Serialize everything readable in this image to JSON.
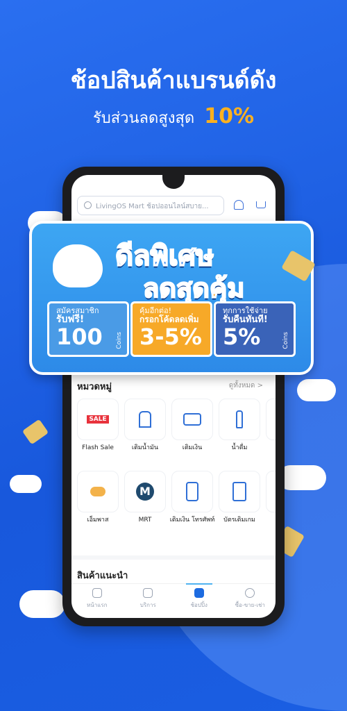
{
  "promo": {
    "headline": "ช้อปสินค้าแบรนด์ดัง",
    "subline": "รับส่วนลดสูงสุด",
    "subline_value": "10%",
    "accent": "#ffb11f"
  },
  "app": {
    "search_placeholder": "LivingOS Mart ช้อปออนไลน์สบาย...",
    "categories_title": "หมวดหมู่",
    "see_all": "ดูทั้งหมด >",
    "categories": [
      {
        "label": "Flash Sale",
        "icon": "flash-sale-icon"
      },
      {
        "label": "เติมน้ำมัน",
        "icon": "fuel-pump-icon"
      },
      {
        "label": "เติมเงิน",
        "icon": "card-topup-icon"
      },
      {
        "label": "น้ำดื่ม",
        "icon": "water-bottle-icon"
      },
      {
        "label": "เอ็มพาส",
        "icon": "mpass-icon"
      },
      {
        "label": "MRT",
        "icon": "mrt-icon"
      },
      {
        "label": "เติมเงิน โทรศัพท์",
        "icon": "phone-topup-icon"
      },
      {
        "label": "บัตรเติมเกม",
        "icon": "game-card-icon"
      }
    ],
    "recommended_title": "สินค้าแนะนำ",
    "nav": [
      {
        "label": "หน้าแรก"
      },
      {
        "label": "บริการ"
      },
      {
        "label": "ช้อปปิ้ง",
        "active": true
      },
      {
        "label": "ซื้อ-ขาย-เช่า"
      }
    ]
  },
  "banner": {
    "title1": "ดีลพิเศษ",
    "title2": "ลดสุดคุ้ม",
    "coupons": [
      {
        "line1": "สมัครสมาชิก",
        "line2": "รับฟรี!",
        "value": "100",
        "unit": "Coins",
        "color": "#4a9be6"
      },
      {
        "line1": "คุ้มอีกต่อ!",
        "line2": "กรอกโค้ดลดเพิ่ม",
        "value": "3-5%",
        "unit": "",
        "color": "#f7a928"
      },
      {
        "line1": "ทุกการใช้จ่าย",
        "line2": "รับคืนทันที!",
        "value": "5%",
        "unit": "Coins",
        "color": "#3a63b8"
      }
    ]
  }
}
